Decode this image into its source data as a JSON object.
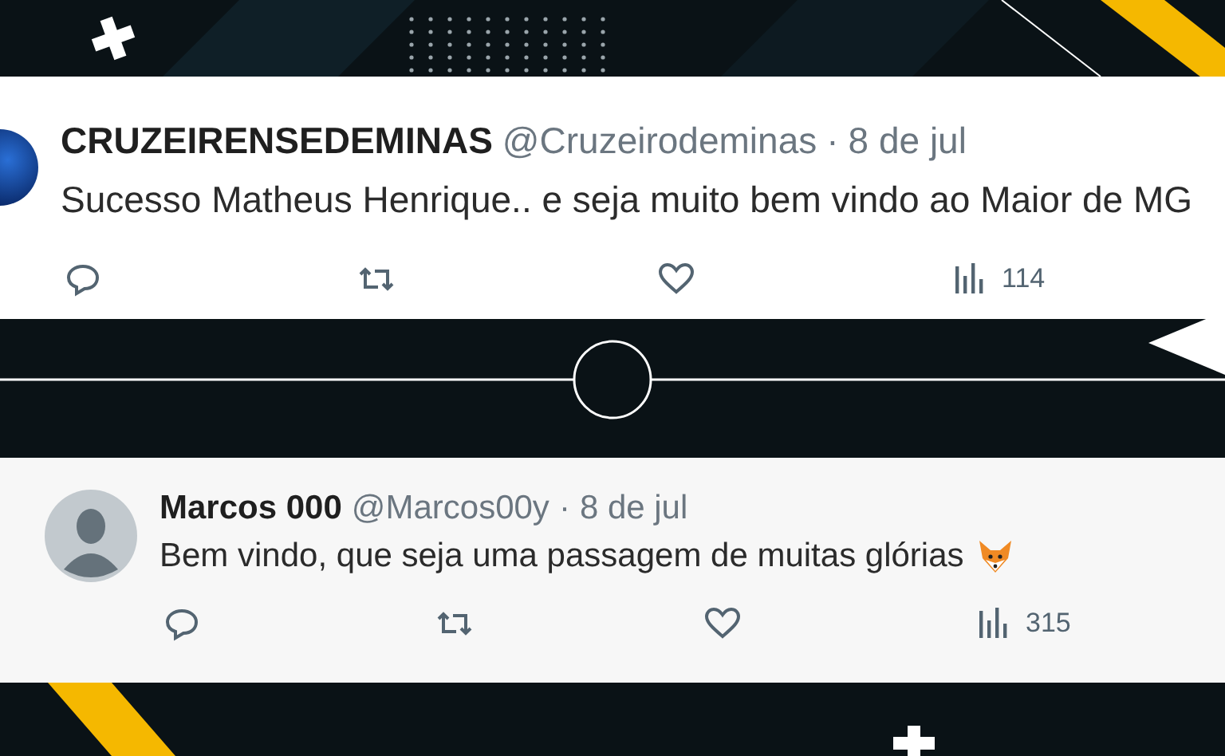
{
  "posts": [
    {
      "name": "CRUZEIRENSEDEMINAS",
      "handle": "@Cruzeirodeminas",
      "separator": "·",
      "date": "8 de jul",
      "text": "Sucesso Matheus Henrique.. e seja muito bem vindo ao Maior de MG",
      "kind": "photo-avatar",
      "emoji": false,
      "views": "114"
    },
    {
      "name": "Marcos 000",
      "handle": "@Marcos00y",
      "separator": "·",
      "date": "8 de jul",
      "text": "Bem vindo, que seja uma passagem de muitas glórias",
      "kind": "default-avatar",
      "emoji": true,
      "views": "315"
    }
  ]
}
